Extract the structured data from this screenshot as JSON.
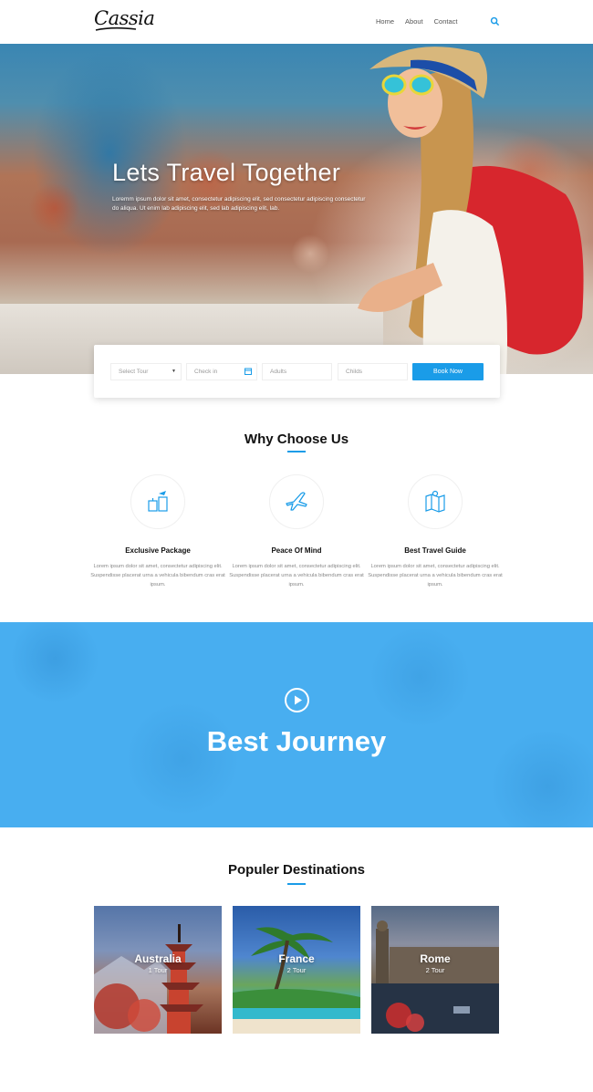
{
  "header": {
    "logo_text": "Cassia",
    "nav": [
      {
        "label": "Home"
      },
      {
        "label": "About"
      },
      {
        "label": "Contact"
      }
    ],
    "search_icon": "search-icon"
  },
  "hero": {
    "title": "Lets Travel Together",
    "subtitle": "Loremm ipsum dolor sit amet, consectetur adipiscing elit, sed consectetur adipiscing consectetur do aliqua. Ut enim lab adipiscing elit, sed lab adipiscing elit, lab."
  },
  "booking": {
    "select_tour": "Select Tour",
    "check_in": "Check in",
    "adults": "Adults",
    "childs": "Childs",
    "book_button": "Book Now"
  },
  "why": {
    "title": "Why Choose Us",
    "features": [
      {
        "title": "Exclusive Package",
        "text": "Lorem ipsum dolor sit amet, consectetur adipiscing elit. Suspendisse placerat urna a vehicula bibendum cras erat ipsum.",
        "icon": "package-icon"
      },
      {
        "title": "Peace Of Mind",
        "text": "Lorem ipsum dolor sit amet, consectetur adipiscing elit. Suspendisse placerat urna a vehicula bibendum cras erat ipsum.",
        "icon": "airplane-icon"
      },
      {
        "title": "Best Travel Guide",
        "text": "Lorem ipsum dolor sit amet, consectetur adipiscing elit. Suspendisse placerat urna a vehicula bibendum cras erat ipsum.",
        "icon": "map-icon"
      }
    ]
  },
  "journey": {
    "title": "Best Journey",
    "play_icon": "play-icon"
  },
  "destinations": {
    "title": "Populer Destinations",
    "cards": [
      {
        "name": "Australia",
        "count": "1 Tour"
      },
      {
        "name": "France",
        "count": "2 Tour"
      },
      {
        "name": "Rome",
        "count": "2 Tour"
      }
    ]
  },
  "colors": {
    "accent": "#1a9ce8",
    "journey_bg": "#48aef0"
  }
}
